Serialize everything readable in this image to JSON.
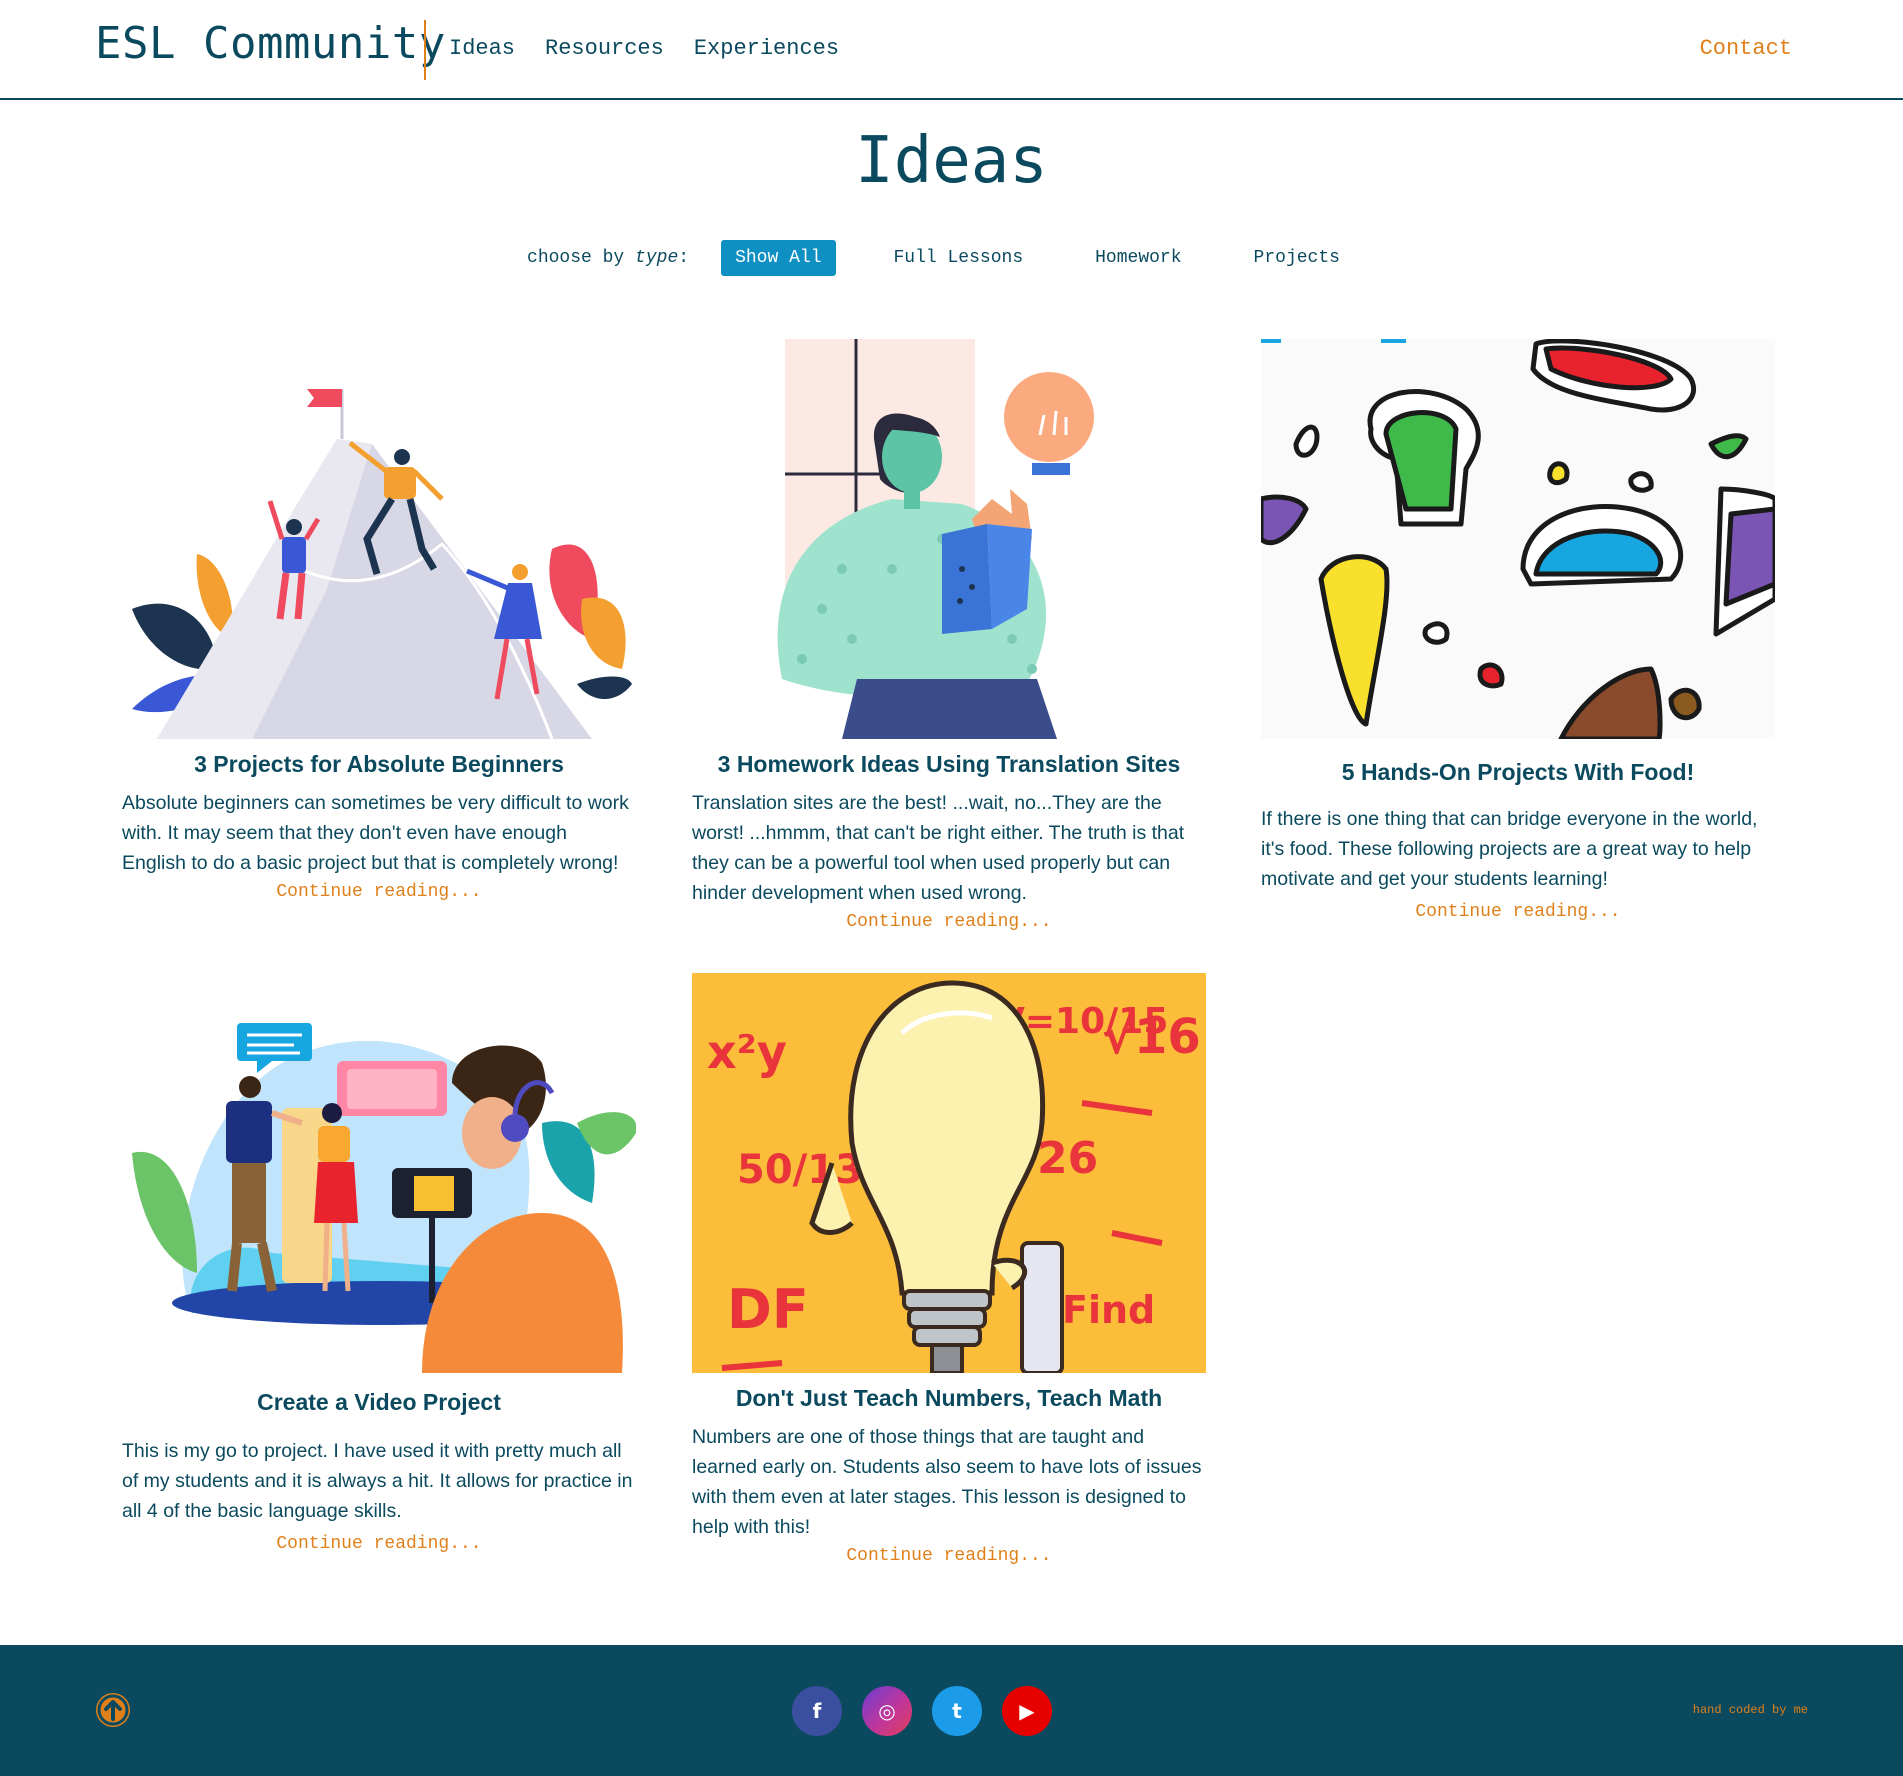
{
  "header": {
    "brand": "ESL Community",
    "nav": [
      "Ideas",
      "Resources",
      "Experiences"
    ],
    "contact": "Contact"
  },
  "page": {
    "title": "Ideas",
    "filter": {
      "label_prefix": "choose by ",
      "label_em": "type",
      "label_suffix": ":",
      "options": [
        "Show All",
        "Full Lessons",
        "Homework",
        "Projects"
      ],
      "selected": "Show All"
    }
  },
  "cards": [
    {
      "title": "3 Projects for Absolute Beginners",
      "excerpt": "Absolute beginners can sometimes be very difficult to work with. It may seem that they don't even have enough English to do a basic project but that is completely wrong!",
      "link": "Continue reading..."
    },
    {
      "title": "3 Homework Ideas Using Translation Sites",
      "excerpt": "Translation sites are the best! ...wait, no...They are the worst! ...hmmm, that can't be right either. The truth is that they can be a powerful tool when used properly but can hinder development when used wrong.",
      "link": "Continue reading..."
    },
    {
      "title": "5 Hands-On Projects With Food!",
      "excerpt": "If there is one thing that can bridge everyone in the world, it's food. These following projects are a great way to help motivate and get your students learning!",
      "link": "Continue reading..."
    },
    {
      "title": "Create a Video Project",
      "excerpt": "This is my go to project. I have used it with pretty much all of my students and it is always a hit. It allows for practice in all 4 of the basic language skills.",
      "link": "Continue reading..."
    },
    {
      "title": "Don't Just Teach Numbers, Teach Math",
      "excerpt": "Numbers are one of those things that are taught and learned early on. Students also seem to have lots of issues with them even at later stages. This lesson is designed to help with this!",
      "link": "Continue reading..."
    }
  ],
  "illustration_text": {
    "math": [
      "x²y",
      "V=10/15",
      "√16",
      "50/13",
      "26",
      "DF",
      "Find"
    ]
  },
  "footer": {
    "social_glyphs": {
      "facebook": "f",
      "instagram": "◎",
      "twitter": "t",
      "youtube": "▶"
    },
    "credit": "hand coded by me"
  },
  "colors": {
    "primary": "#0b4a5e",
    "accent": "#e0801a",
    "active_filter": "#0e90c2",
    "footer_bg": "#0b4a5e"
  }
}
